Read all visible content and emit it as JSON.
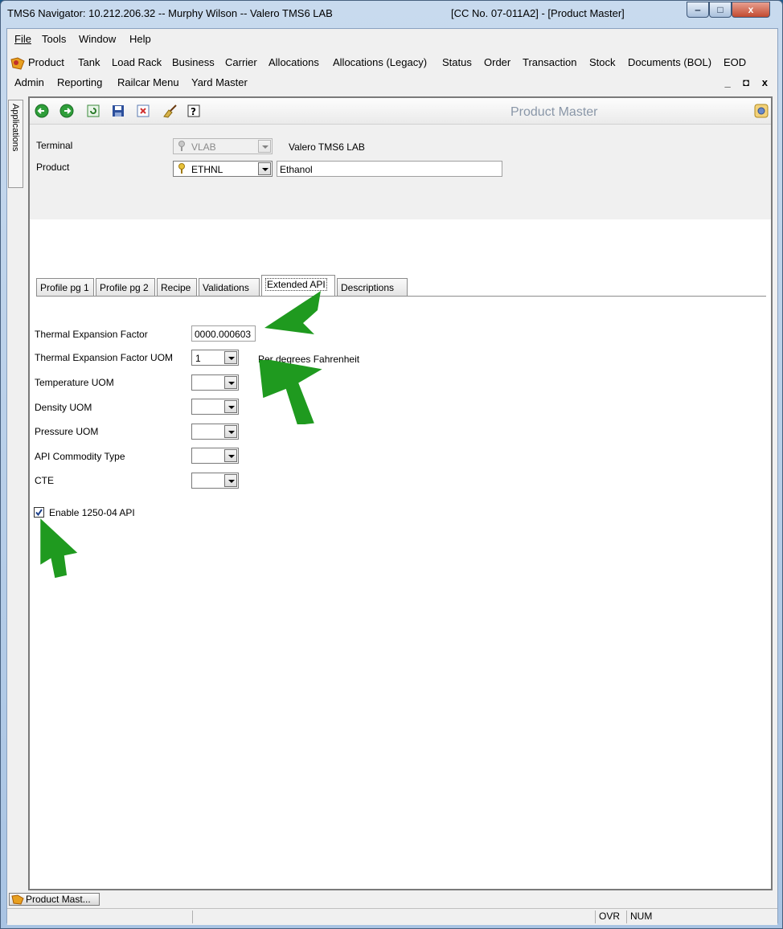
{
  "window": {
    "title": "TMS6 Navigator: 10.212.206.32 -- Murphy Wilson -- Valero TMS6 LAB",
    "title_right": "[CC No. 07-011A2] - [Product Master]",
    "minimize": "‒",
    "maximize": "□",
    "close": "x"
  },
  "menu": {
    "row1": [
      "File",
      "Tools",
      "Window",
      "Help"
    ],
    "row2": [
      "Product",
      "Tank",
      "Load Rack",
      "Business",
      "Carrier",
      "Allocations",
      "Allocations (Legacy)",
      "Status",
      "Order",
      "Transaction",
      "Stock",
      "Documents (BOL)",
      "EOD"
    ],
    "row3": [
      "Admin",
      "Reporting",
      "Railcar Menu",
      "Yard Master"
    ],
    "mdi_controls": "_ ◘ x"
  },
  "sidebar": {
    "applications_label": "Applications"
  },
  "toolbar": {
    "title": "Product Master"
  },
  "header": {
    "terminal_label": "Terminal",
    "terminal_value": "VLAB",
    "terminal_name": "Valero TMS6 LAB",
    "product_label": "Product",
    "product_value": "ETHNL",
    "product_name": "Ethanol"
  },
  "tabs": [
    "Profile pg 1",
    "Profile pg 2",
    "Recipe",
    "Validations",
    "Extended API",
    "Descriptions"
  ],
  "active_tab": "Extended API",
  "form": {
    "thermal_expansion_factor_label": "Thermal Expansion Factor",
    "thermal_expansion_factor_value": "0000.000603",
    "thermal_expansion_uom_label": "Thermal Expansion Factor UOM",
    "thermal_expansion_uom_value": "1",
    "thermal_expansion_uom_desc": "Per degrees Fahrenheit",
    "temperature_uom_label": "Temperature UOM",
    "density_uom_label": "Density UOM",
    "pressure_uom_label": "Pressure UOM",
    "api_commodity_type_label": "API Commodity Type",
    "cte_label": "CTE",
    "enable_api_label": "Enable 1250-04 API",
    "enable_api_checked": true
  },
  "taskbar": {
    "product_master_button": "Product Mast..."
  },
  "statusbar": {
    "ovr": "OVR",
    "num": "NUM"
  },
  "colors": {
    "arrow": "#1f9a1f",
    "titlebar": "#b9d1ea"
  }
}
